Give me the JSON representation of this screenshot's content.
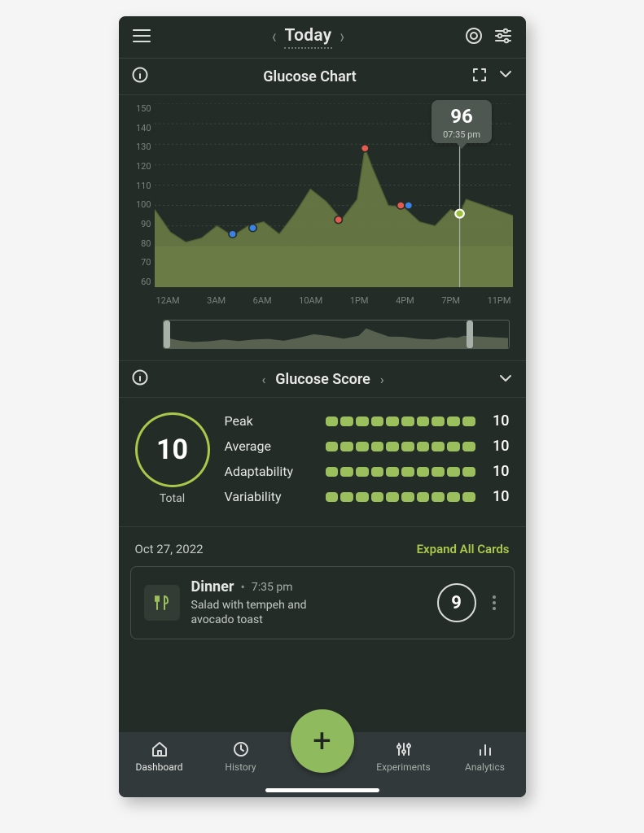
{
  "header": {
    "date_label": "Today"
  },
  "glucose_chart": {
    "title": "Glucose Chart",
    "tooltip": {
      "value": "96",
      "time": "07:35 pm"
    }
  },
  "chart_data": {
    "type": "area",
    "xlabel": "",
    "ylabel": "",
    "ylim": [
      60,
      150
    ],
    "target_band": [
      60,
      80
    ],
    "x_ticks": [
      "12AM",
      "3AM",
      "6AM",
      "10AM",
      "1PM",
      "4PM",
      "7PM",
      "11PM"
    ],
    "y_ticks": [
      150,
      140,
      130,
      120,
      110,
      100,
      90,
      80,
      70,
      60
    ],
    "series": [
      {
        "name": "glucose",
        "x_hours": [
          0,
          1,
          2,
          3,
          4,
          5,
          6,
          7,
          8,
          9,
          10,
          11,
          12,
          13,
          13.5,
          14,
          15,
          16,
          17,
          18,
          19,
          19.58,
          20,
          23
        ],
        "values": [
          98,
          87,
          82,
          84,
          90,
          85,
          90,
          92,
          86,
          96,
          108,
          102,
          93,
          103,
          128,
          118,
          100,
          99,
          92,
          90,
          98,
          96,
          103,
          95
        ]
      }
    ],
    "events": [
      {
        "type": "blue",
        "x_hour": 5.0,
        "y": 86
      },
      {
        "type": "blue",
        "x_hour": 6.3,
        "y": 89
      },
      {
        "type": "red",
        "x_hour": 11.8,
        "y": 93
      },
      {
        "type": "red",
        "x_hour": 13.5,
        "y": 128
      },
      {
        "type": "red",
        "x_hour": 15.8,
        "y": 100
      },
      {
        "type": "blue",
        "x_hour": 16.3,
        "y": 100
      },
      {
        "type": "now",
        "x_hour": 19.58,
        "y": 96
      }
    ]
  },
  "glucose_score": {
    "title": "Glucose Score",
    "total_label": "Total",
    "total_value": "10",
    "rows": [
      {
        "label": "Peak",
        "value": "10",
        "filled": 10
      },
      {
        "label": "Average",
        "value": "10",
        "filled": 10
      },
      {
        "label": "Adaptability",
        "value": "10",
        "filled": 10
      },
      {
        "label": "Variability",
        "value": "10",
        "filled": 10
      }
    ]
  },
  "log": {
    "date": "Oct 27, 2022",
    "expand_label": "Expand All Cards",
    "meal": {
      "title": "Dinner",
      "time": "7:35 pm",
      "description": "Salad with tempeh and avocado toast",
      "score": "9"
    }
  },
  "tabs": {
    "dashboard": "Dashboard",
    "history": "History",
    "experiments": "Experiments",
    "analytics": "Analytics"
  }
}
